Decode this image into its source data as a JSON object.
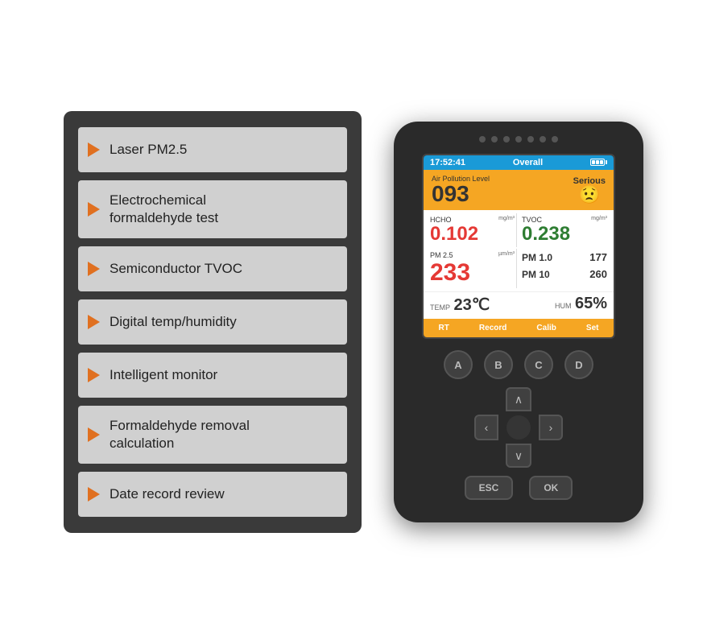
{
  "leftPanel": {
    "features": [
      {
        "id": "laser-pm25",
        "label": "Laser PM2.5"
      },
      {
        "id": "electrochemical",
        "label": "Electrochemical\nformaldehyde test"
      },
      {
        "id": "semiconductor-tvoc",
        "label": "Semiconductor TVOC"
      },
      {
        "id": "digital-temp",
        "label": "Digital temp/humidity"
      },
      {
        "id": "intelligent-monitor",
        "label": "Intelligent monitor"
      },
      {
        "id": "formaldehyde-removal",
        "label": "Formaldehyde removal\ncalculation"
      },
      {
        "id": "date-record",
        "label": "Date record review"
      }
    ]
  },
  "device": {
    "screen": {
      "header": {
        "time": "17:52:41",
        "mode": "Overall",
        "battery": "full"
      },
      "aqi": {
        "label": "Air Pollution Level",
        "value": "093",
        "status": "Serious"
      },
      "readings": {
        "hcho": {
          "name": "HCHO",
          "unit": "mg/m³",
          "value": "0.102",
          "color": "red"
        },
        "tvoc": {
          "name": "TVOC",
          "unit": "mg/m³",
          "value": "0.238",
          "color": "green"
        },
        "pm25": {
          "name": "PM 2.5",
          "unit": "µm/m³",
          "value": "233",
          "color": "red"
        },
        "pm10_val": {
          "name": "PM 1.0",
          "value": "177"
        },
        "pm10_label": {
          "name": "PM 10",
          "value": "260"
        }
      },
      "enviro": {
        "temp": "23",
        "tempUnit": "℃",
        "humidity": "65",
        "humidityUnit": "%"
      },
      "tabs": [
        {
          "id": "rt",
          "label": "RT"
        },
        {
          "id": "record",
          "label": "Record"
        },
        {
          "id": "calib",
          "label": "Calib"
        },
        {
          "id": "set",
          "label": "Set"
        }
      ]
    },
    "buttons": {
      "abcd": [
        "A",
        "B",
        "C",
        "D"
      ],
      "dpad": {
        "up": "∧",
        "down": "∨",
        "left": "‹",
        "right": "›"
      },
      "esc": "ESC",
      "ok": "OK"
    }
  },
  "colors": {
    "orange": "#f5a623",
    "deviceBg": "#2a2a2a",
    "red": "#e53935",
    "green": "#2e7d32",
    "blue": "#1a9ad7"
  }
}
